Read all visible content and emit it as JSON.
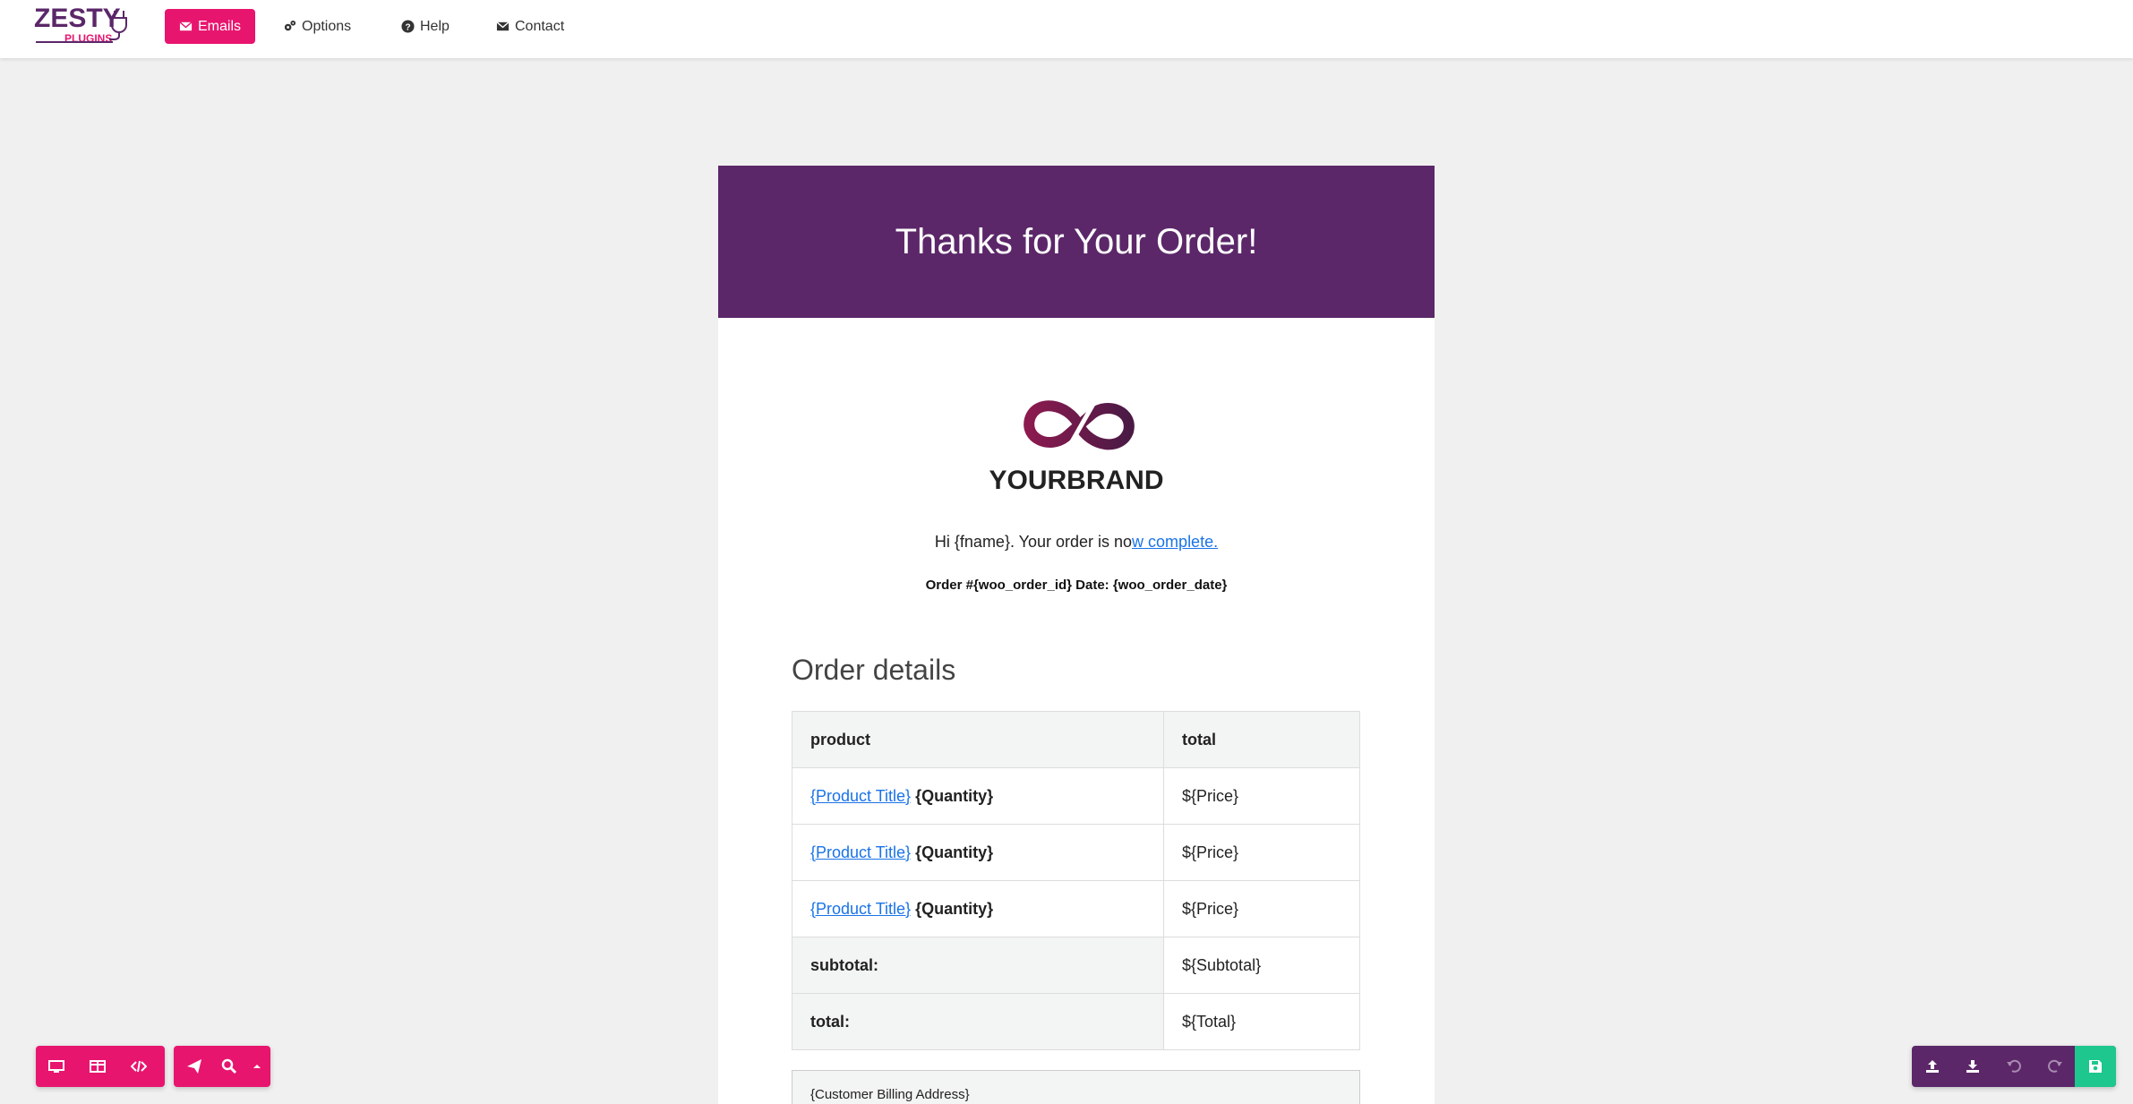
{
  "app": {
    "logo": {
      "main": "ZESTY",
      "sub": "PLUGINS"
    },
    "nav": [
      {
        "label": "Emails",
        "icon": "envelope-icon",
        "active": true
      },
      {
        "label": "Options",
        "icon": "cogs-icon",
        "active": false
      },
      {
        "label": "Help",
        "icon": "question-circle-icon",
        "active": false
      },
      {
        "label": "Contact",
        "icon": "envelope-icon",
        "active": false
      }
    ],
    "colors": {
      "accent": "#e8156f",
      "brand": "#5b2769",
      "save": "#1dc78e",
      "background": "#f0f0f0"
    }
  },
  "email": {
    "hero_title": "Thanks for Your Order!",
    "brand_name": "YOURBRAND",
    "greeting_prefix": "Hi {fname}.  Your order is no",
    "greeting_link": "w complete.",
    "order_meta": "Order #{woo_order_id} Date: {woo_order_date}",
    "section_title": "Order details",
    "table": {
      "headers": [
        "product",
        "total"
      ],
      "rows": [
        {
          "product_link": "{Product Title}",
          "quantity": "{Quantity}",
          "total": "${Price}"
        },
        {
          "product_link": "{Product Title}",
          "quantity": "{Quantity}",
          "total": "${Price}"
        },
        {
          "product_link": "{Product Title}",
          "quantity": "{Quantity}",
          "total": "${Price}"
        }
      ],
      "summary": [
        {
          "label": "subtotal:",
          "value": "${Subtotal}"
        },
        {
          "label": "total:",
          "value": "${Total}"
        }
      ]
    },
    "billing_address": "{Customer Billing Address}"
  },
  "toolbars": {
    "left_view": [
      "desktop-icon",
      "columns-icon",
      "code-icon"
    ],
    "left_actions": [
      "send-icon",
      "search-icon",
      "caret-up-icon"
    ],
    "right": [
      "upload-icon",
      "download-icon",
      "undo-icon",
      "redo-icon",
      "save-icon"
    ]
  }
}
